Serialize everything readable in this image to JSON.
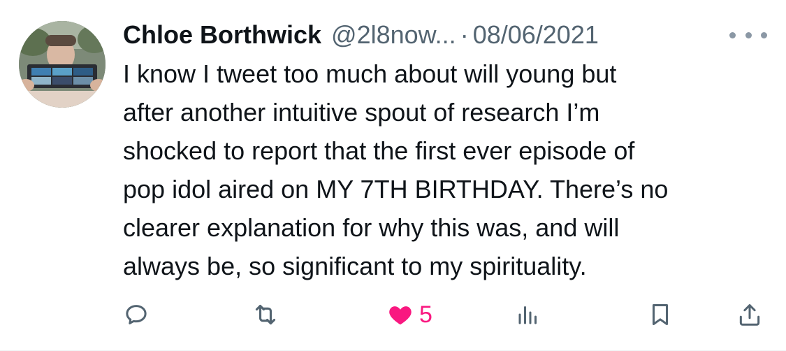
{
  "tweet": {
    "author_name": "Chloe Borthwick",
    "handle": "@2l8now...",
    "separator": "·",
    "date": "08/06/2021",
    "text": "I know I tweet too much about will young but\nafter another intuitive spout of research I’m\nshocked to report that the first ever episode of\npop idol aired on MY 7TH BIRTHDAY. There’s no\nclearer explanation for why this was, and will\nalways be, so significant to my spirituality."
  },
  "actions": {
    "reply_icon": "reply-icon",
    "retweet_icon": "retweet-icon",
    "like_icon": "heart-icon",
    "like_count": "5",
    "views_icon": "views-icon",
    "bookmark_icon": "bookmark-icon",
    "share_icon": "share-icon"
  },
  "colors": {
    "text": "#0f1419",
    "secondary": "#536471",
    "like_active": "#f91880",
    "icon": "#536471"
  }
}
